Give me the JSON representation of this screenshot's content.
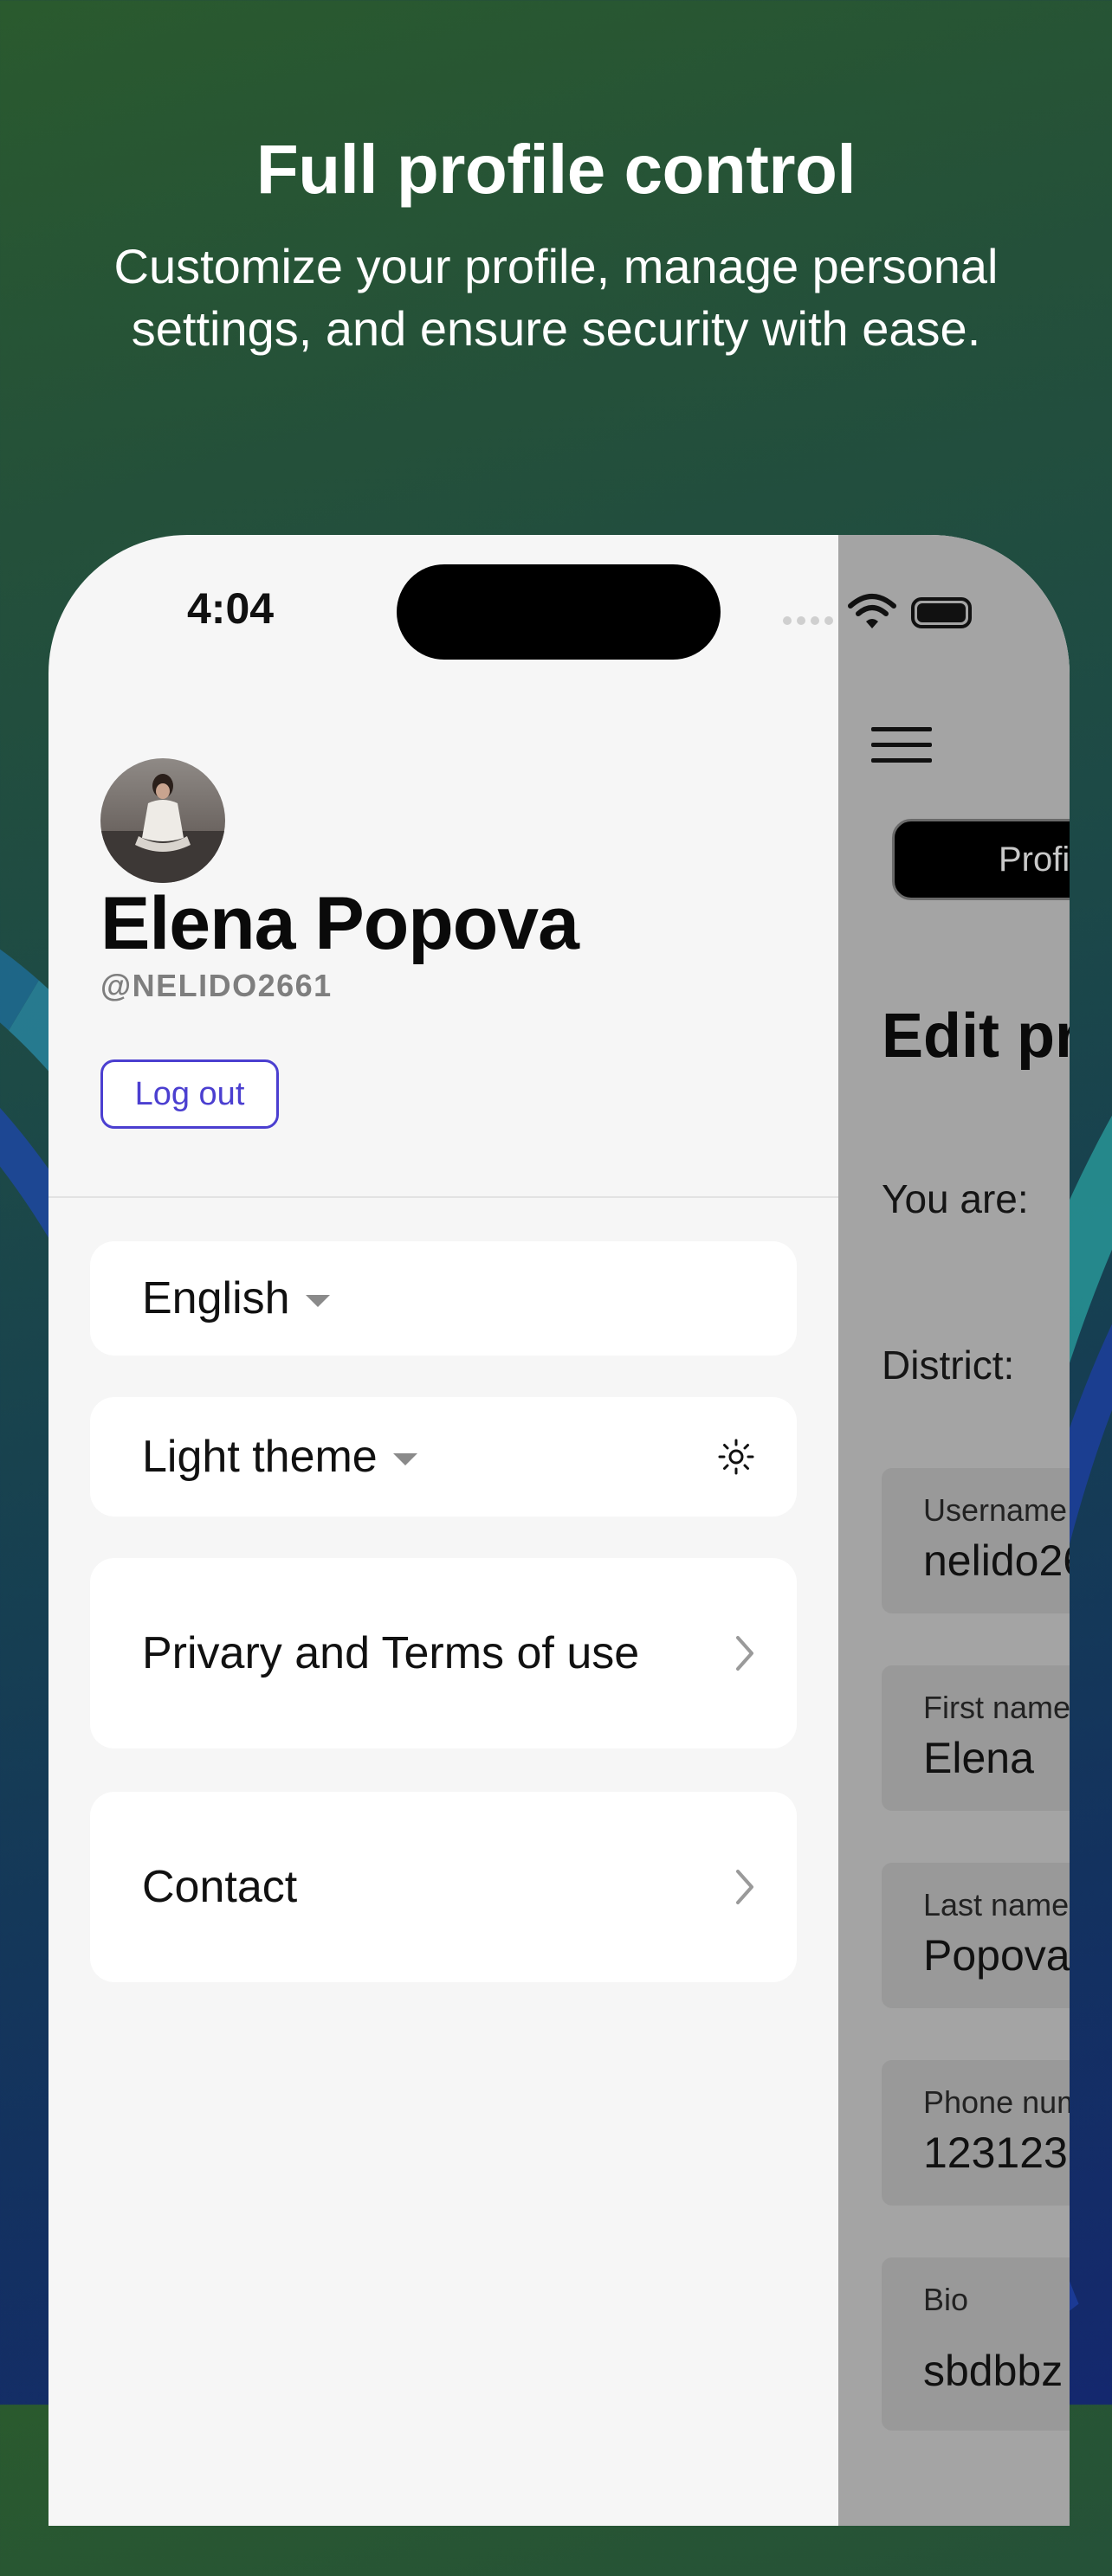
{
  "promo": {
    "title": "Full profile control",
    "subtitle": "Customize your profile, manage personal settings, and ensure security with ease."
  },
  "status_bar": {
    "time": "4:04"
  },
  "profile": {
    "name": "Elena Popova",
    "handle": "@NELIDO2661",
    "logout_label": "Log out"
  },
  "settings": {
    "language": "English",
    "theme": "Light theme",
    "privacy": "Privary and Terms of use",
    "contact": "Contact"
  },
  "edit_panel": {
    "tab_label": "Profi",
    "title": "Edit pr",
    "you_are_label": "You are:",
    "district_label": "District:",
    "fields": [
      {
        "label": "Username",
        "value": "nelido26"
      },
      {
        "label": "First name",
        "value": "Elena"
      },
      {
        "label": "Last name",
        "value": "Popova"
      },
      {
        "label": "Phone num",
        "value": "1231231"
      },
      {
        "label": "Bio",
        "value": "sbdbbz"
      }
    ]
  },
  "colors": {
    "accent": "#4b3fd0",
    "panel_bg": "#f6f6f6",
    "overlay": "#a4a4a4"
  }
}
